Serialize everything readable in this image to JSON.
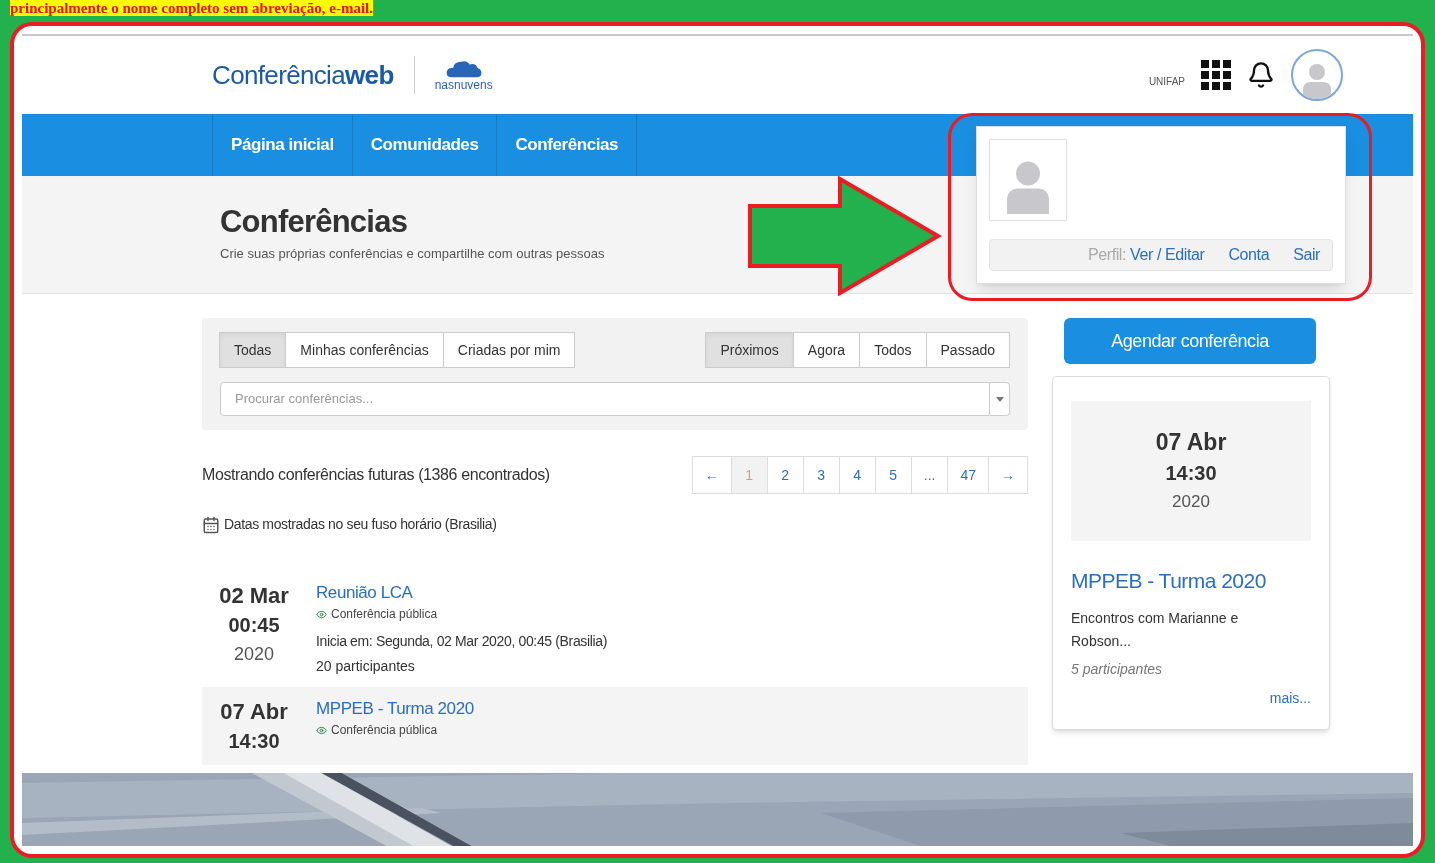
{
  "annotation": {
    "text": "principalmente o nome completo sem abreviação, e-mail."
  },
  "header": {
    "logo_main": "Conferência",
    "logo_bold": "web",
    "partner_logo": "nasnuvens",
    "org": "UNIFAP"
  },
  "nav": [
    "Página inicial",
    "Comunidades",
    "Conferências"
  ],
  "page_title": "Conferências",
  "page_subtitle": "Crie suas próprias conferências e compartilhe com outras pessoas",
  "filters": {
    "scope": [
      {
        "label": "Todas",
        "selected": true
      },
      {
        "label": "Minhas conferências",
        "selected": false
      },
      {
        "label": "Criadas por mim",
        "selected": false
      }
    ],
    "time": [
      {
        "label": "Próximos",
        "selected": true
      },
      {
        "label": "Agora",
        "selected": false
      },
      {
        "label": "Todos",
        "selected": false
      },
      {
        "label": "Passado",
        "selected": false
      }
    ],
    "search_placeholder": "Procurar conferências..."
  },
  "results_summary": "Mostrando conferências futuras (1386 encontrados)",
  "pagination": [
    {
      "label": "←",
      "selected": false
    },
    {
      "label": "1",
      "selected": true
    },
    {
      "label": "2",
      "selected": false
    },
    {
      "label": "3",
      "selected": false
    },
    {
      "label": "4",
      "selected": false
    },
    {
      "label": "5",
      "selected": false
    },
    {
      "label": "...",
      "selected": false
    },
    {
      "label": "47",
      "selected": false
    },
    {
      "label": "→",
      "selected": false
    }
  ],
  "timezone_note": "Datas mostradas no seu fuso horário (Brasilia)",
  "conferences": [
    {
      "day_month": "02 Mar",
      "time": "00:45",
      "year": "2020",
      "title": "Reunião LCA",
      "visibility": "Conferência pública",
      "starts": "Inicia em: Segunda, 02 Mar 2020, 00:45 (Brasilia)",
      "participants": "20 participantes"
    },
    {
      "day_month": "07 Abr",
      "time": "14:30",
      "title": "MPPEB - Turma 2020",
      "visibility": "Conferência pública"
    }
  ],
  "sidebar": {
    "button": "Agendar conferência",
    "featured": {
      "day_month": "07 Abr",
      "time": "14:30",
      "year": "2020",
      "title": "MPPEB - Turma 2020",
      "description": "Encontros com Marianne e Robson...",
      "participants": "5 participantes",
      "more": "mais..."
    }
  },
  "profile_menu": {
    "label": "Perfil:",
    "links": [
      "Ver / Editar",
      "Conta",
      "Sair"
    ]
  }
}
